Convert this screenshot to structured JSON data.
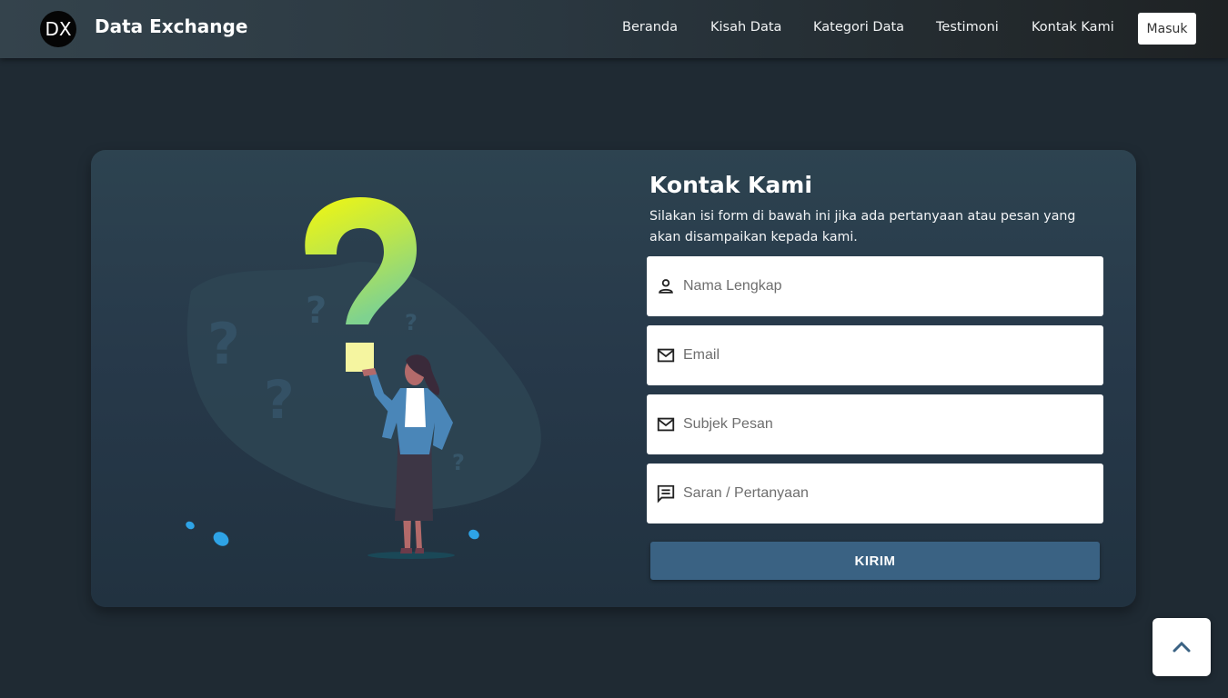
{
  "brand": {
    "logo_text": "DX",
    "name": "Data Exchange"
  },
  "nav": {
    "items": [
      {
        "label": "Beranda"
      },
      {
        "label": "Kisah Data"
      },
      {
        "label": "Kategori Data"
      },
      {
        "label": "Testimoni"
      },
      {
        "label": "Kontak Kami"
      }
    ],
    "login_label": "Masuk"
  },
  "contact": {
    "title": "Kontak Kami",
    "description": "Silakan isi form di bawah ini jika ada pertanyaan atau pesan yang akan disampaikan kepada kami.",
    "fields": [
      {
        "placeholder": "Nama Lengkap",
        "icon": "person-icon",
        "value": ""
      },
      {
        "placeholder": "Email",
        "icon": "mail-icon",
        "value": ""
      },
      {
        "placeholder": "Subjek Pesan",
        "icon": "mail-icon",
        "value": ""
      },
      {
        "placeholder": "Saran / Pertanyaan",
        "icon": "message-icon",
        "value": ""
      }
    ],
    "submit_label": "KIRIM"
  },
  "scroll_top": {
    "icon": "chevron-up-icon"
  },
  "colors": {
    "page_bg": "#1f2a33",
    "card_bg": "#27394a",
    "button": "#3a6283",
    "accent_yellow": "#e6f516",
    "accent_green": "#8bd48b",
    "leaf_blue": "#2ea3e6"
  }
}
